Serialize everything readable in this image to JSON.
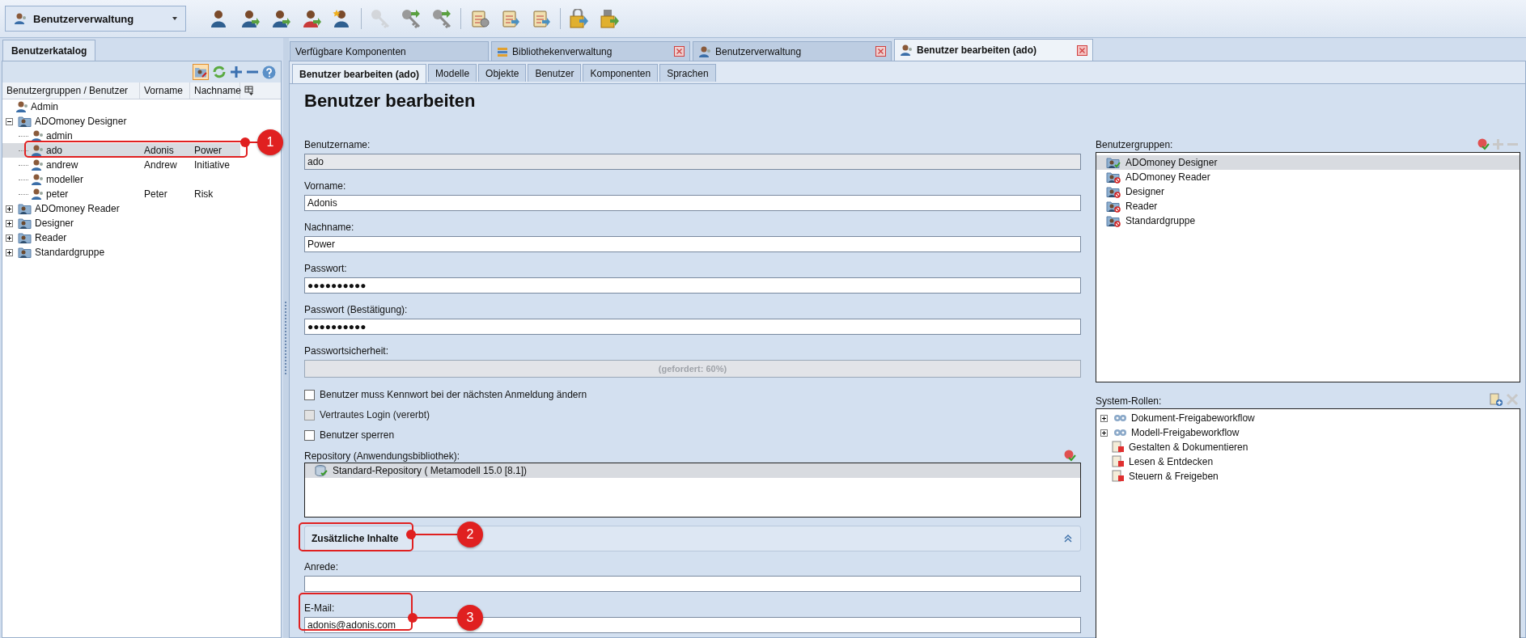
{
  "toolbar": {
    "module_selector": "Benutzerverwaltung",
    "groups": [
      [
        {
          "disabled": false
        },
        {
          "disabled": false
        },
        {
          "disabled": false
        },
        {
          "disabled": false
        },
        {
          "disabled": false
        }
      ],
      [
        {
          "disabled": true
        },
        {
          "disabled": false
        },
        {
          "disabled": false
        }
      ],
      [
        {
          "disabled": false
        },
        {
          "disabled": false
        },
        {
          "disabled": false
        }
      ],
      [
        {
          "disabled": false
        },
        {
          "disabled": false
        }
      ]
    ]
  },
  "sidebar": {
    "tab": {
      "label": "Benutzerkatalog",
      "selected": true
    },
    "columns": [
      "Benutzergruppen / Benutzer",
      "Vorname",
      "Nachname"
    ],
    "tree": [
      {
        "kind": "user",
        "name": "Admin",
        "selected": false
      },
      {
        "kind": "group",
        "name": "ADOmoney Designer",
        "expanded": true,
        "selected": false,
        "children": [
          {
            "kind": "user",
            "name": "admin",
            "selected": false
          },
          {
            "kind": "user",
            "name": "ado",
            "first_name": "Adonis",
            "last_name": "Power",
            "selected": true
          },
          {
            "kind": "user",
            "name": "andrew",
            "first_name": "Andrew",
            "last_name": "Initiative",
            "selected": false
          },
          {
            "kind": "user",
            "name": "modeller",
            "selected": false
          },
          {
            "kind": "user",
            "name": "peter",
            "first_name": "Peter",
            "last_name": "Risk",
            "selected": false
          }
        ]
      },
      {
        "kind": "group",
        "name": "ADOmoney Reader",
        "expanded": false,
        "selected": false
      },
      {
        "kind": "group",
        "name": "Designer",
        "expanded": false,
        "selected": false
      },
      {
        "kind": "group",
        "name": "Reader",
        "expanded": false,
        "selected": false
      },
      {
        "kind": "group",
        "name": "Standardgruppe",
        "expanded": false,
        "selected": false
      }
    ]
  },
  "tabs": [
    {
      "label": "Verfügbare Komponenten",
      "closable": false,
      "selected": false
    },
    {
      "label": "Bibliothekenverwaltung",
      "closable": true,
      "selected": false
    },
    {
      "label": "Benutzerverwaltung",
      "closable": true,
      "selected": false
    },
    {
      "label": "Benutzer bearbeiten (ado)",
      "closable": true,
      "selected": true
    }
  ],
  "subtabs": [
    {
      "label": "Benutzer bearbeiten (ado)",
      "selected": true
    },
    {
      "label": "Modelle",
      "selected": false
    },
    {
      "label": "Objekte",
      "selected": false
    },
    {
      "label": "Benutzer",
      "selected": false
    },
    {
      "label": "Komponenten",
      "selected": false
    },
    {
      "label": "Sprachen",
      "selected": false
    }
  ],
  "form": {
    "heading": "Benutzer bearbeiten",
    "fields": [
      {
        "label": "Benutzername:",
        "value": "ado",
        "disabled": true
      },
      {
        "label": "Vorname:",
        "value": "Adonis",
        "disabled": false
      },
      {
        "label": "Nachname:",
        "value": "Power",
        "disabled": false
      },
      {
        "label": "Passwort:",
        "value": "●●●●●●●●●●",
        "disabled": false
      },
      {
        "label": "Passwort (Bestätigung):",
        "value": "●●●●●●●●●●",
        "disabled": false
      }
    ],
    "strength": {
      "label": "Passwortsicherheit:",
      "level": 0,
      "reading": "(gefordert: 60%)"
    },
    "checkboxes": [
      {
        "label": "Benutzer muss Kennwort bei der nächsten Anmeldung ändern",
        "checked": false,
        "disabled": false
      },
      {
        "label": "Vertrautes Login (vererbt)",
        "checked": false,
        "disabled": true
      },
      {
        "label": "Benutzer sperren",
        "checked": false,
        "disabled": false
      }
    ],
    "repository": {
      "label": "Repository (Anwendungsbibliothek):",
      "items": [
        {
          "name": "Standard-Repository ( Metamodell 15.0 [8.1])",
          "selected": true
        }
      ]
    },
    "section": {
      "title": "Zusätzliche Inhalte",
      "expanded": true
    },
    "extra_fields": [
      {
        "label": "Anrede:"
      },
      {
        "label": "E-Mail:",
        "value": "adonis@adonis.com"
      }
    ]
  },
  "groups_panel": {
    "label": "Benutzergruppen:",
    "items": [
      {
        "name": "ADOmoney Designer",
        "member": true,
        "selected": true
      },
      {
        "name": "ADOmoney Reader",
        "member": false,
        "selected": false
      },
      {
        "name": "Designer",
        "member": false,
        "selected": false
      },
      {
        "name": "Reader",
        "member": false,
        "selected": false
      },
      {
        "name": "Standardgruppe",
        "member": false,
        "selected": false
      }
    ]
  },
  "roles_panel": {
    "label": "System-Rollen:",
    "items": [
      {
        "kind": "workflow",
        "name": "Dokument-Freigabeworkflow",
        "expanded": false
      },
      {
        "kind": "workflow",
        "name": "Modell-Freigabeworkflow",
        "expanded": false
      },
      {
        "kind": "role",
        "name": "Gestalten & Dokumentieren"
      },
      {
        "kind": "role",
        "name": "Lesen & Entdecken"
      },
      {
        "kind": "role",
        "name": "Steuern & Freigeben"
      }
    ]
  },
  "annotations": [
    {
      "number": "1"
    },
    {
      "number": "2"
    },
    {
      "number": "3"
    }
  ]
}
